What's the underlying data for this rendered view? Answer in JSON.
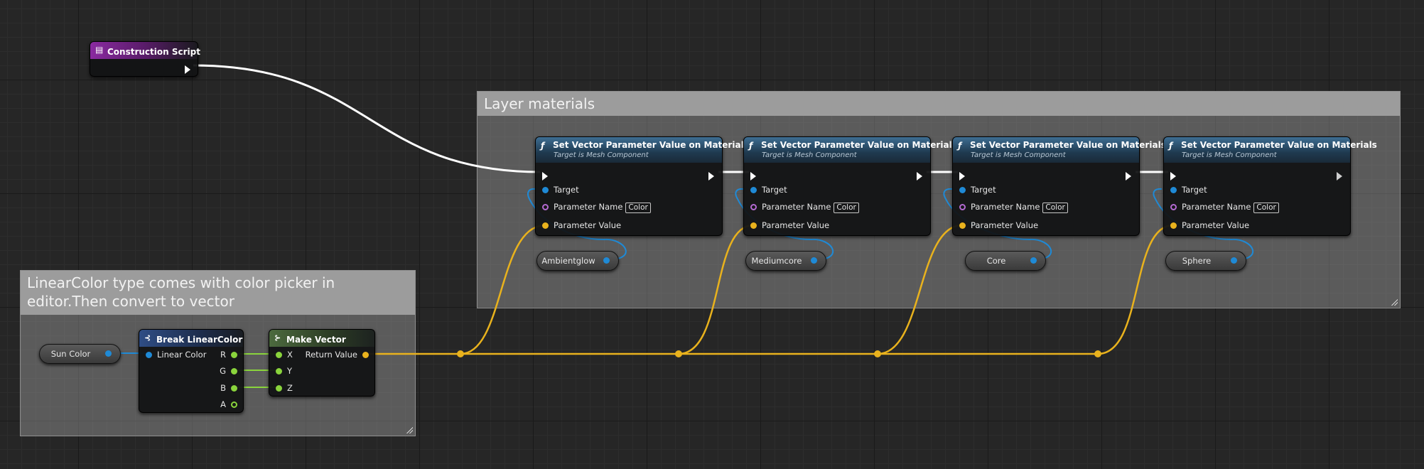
{
  "comments": {
    "layer_materials": "Layer materials",
    "linearcolor_note": "LinearColor type comes with color picker in editor.Then convert to vector"
  },
  "construction_script": {
    "title": "Construction Script"
  },
  "set_vector_node": {
    "title": "Set Vector Parameter Value on Materials",
    "subtitle": "Target is Mesh Component",
    "pin_target": "Target",
    "pin_param_name": "Parameter Name",
    "param_name_value": "Color",
    "pin_param_value": "Parameter Value"
  },
  "set_vector_nodes": [
    {
      "target_var": "Ambientglow"
    },
    {
      "target_var": "Mediumcore"
    },
    {
      "target_var": "Core"
    },
    {
      "target_var": "Sphere"
    }
  ],
  "sun_color": {
    "label": "Sun Color"
  },
  "break_linearcolor": {
    "title": "Break LinearColor",
    "input": "Linear Color",
    "outputs": [
      "R",
      "G",
      "B",
      "A"
    ]
  },
  "make_vector": {
    "title": "Make Vector",
    "inputs": [
      "X",
      "Y",
      "Z"
    ],
    "output": "Return Value"
  },
  "colors": {
    "exec_wire": "#ffffff",
    "vector_wire": "#e9b21d",
    "object_wire": "#1f8ad6",
    "float_wire": "#8ad43c",
    "name_pin": "#b46ad2",
    "function_header": "#3e6e93",
    "event_header": "#8a2aa0"
  },
  "icons": {
    "function": "function-f-icon",
    "event": "event-icon",
    "break_struct": "break-struct-icon",
    "make_struct": "make-struct-icon"
  }
}
